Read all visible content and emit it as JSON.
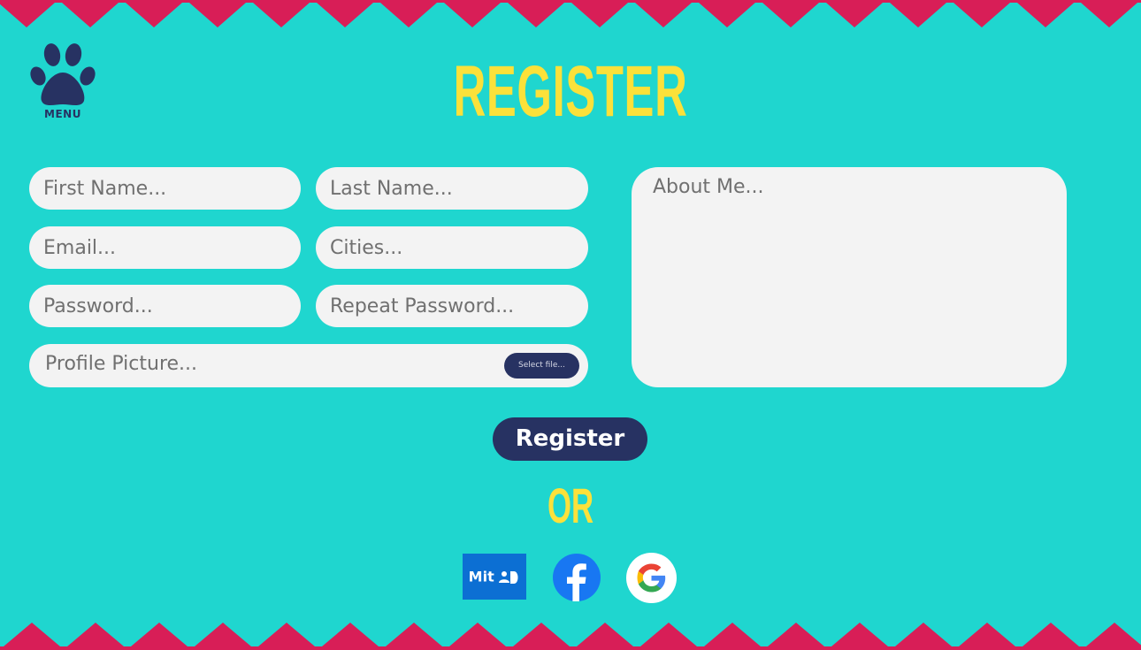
{
  "menu": {
    "label": "MENU",
    "icon": "paw-icon"
  },
  "title": "REGISTER",
  "form": {
    "first_name": {
      "placeholder": "First Name..."
    },
    "last_name": {
      "placeholder": "Last Name..."
    },
    "email": {
      "placeholder": "Email..."
    },
    "cities": {
      "placeholder": "Cities..."
    },
    "password": {
      "placeholder": "Password..."
    },
    "repeat_password": {
      "placeholder": "Repeat Password..."
    },
    "profile_picture": {
      "label": "Profile Picture...",
      "button_label": "Select file..."
    },
    "about": {
      "placeholder": "About Me..."
    }
  },
  "register_button": "Register",
  "or_text": "OR",
  "social": {
    "mitid": {
      "label": "Mit",
      "icon": "mitid-icon"
    },
    "facebook": {
      "icon": "facebook-icon"
    },
    "google": {
      "icon": "google-icon"
    }
  },
  "colors": {
    "background": "#1fd6cf",
    "zigzag": "#d81e57",
    "title_yellow": "#fbe13a",
    "navy": "#273262",
    "field_bg": "#f3f3f3",
    "mitid_blue": "#0c6fd3",
    "facebook_blue": "#1877f2"
  }
}
